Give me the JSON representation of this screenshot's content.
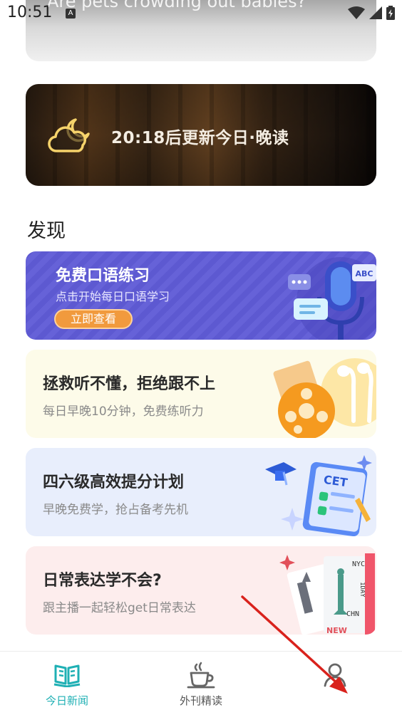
{
  "status_bar": {
    "time": "10:51",
    "notif_icon": "A"
  },
  "top_card": {
    "title": "Are pets crowding out babies?"
  },
  "evening_banner": {
    "text": "20:18后更新今日·晚读"
  },
  "discover": {
    "title": "发现",
    "cards": [
      {
        "title": "免费口语练习",
        "subtitle": "点击开始每日口语学习",
        "button": "立即查看",
        "art_icon": "microphone-icon",
        "art_label": "ABC"
      },
      {
        "title": "拯救听不懂，拒绝跟不上",
        "subtitle": "每日早晚10分钟，免费练听力",
        "art_icon": "film-reel-earphones-icon"
      },
      {
        "title": "四六级高效提分计划",
        "subtitle": "早晚免费学，抢占备考先机",
        "art_icon": "cet-checklist-icon",
        "art_label": "CET"
      },
      {
        "title": "日常表达学不会?",
        "subtitle": "跟主播一起轻松get日常表达",
        "art_icon": "travel-tickets-icon",
        "art_labels": [
          "NYC",
          "1DAY",
          "CHN",
          "NEW"
        ]
      }
    ]
  },
  "bottom_nav": {
    "items": [
      {
        "label": "今日新闻",
        "icon": "open-book-icon",
        "active": true
      },
      {
        "label": "外刊精读",
        "icon": "coffee-cup-icon",
        "active": false
      },
      {
        "label": "",
        "icon": "profile-icon",
        "active": false
      }
    ]
  },
  "colors": {
    "accent": "#1fb0b4",
    "oral_card": "#5d59d1",
    "oral_button": "#f19a3d",
    "annotation": "#d9221c"
  }
}
